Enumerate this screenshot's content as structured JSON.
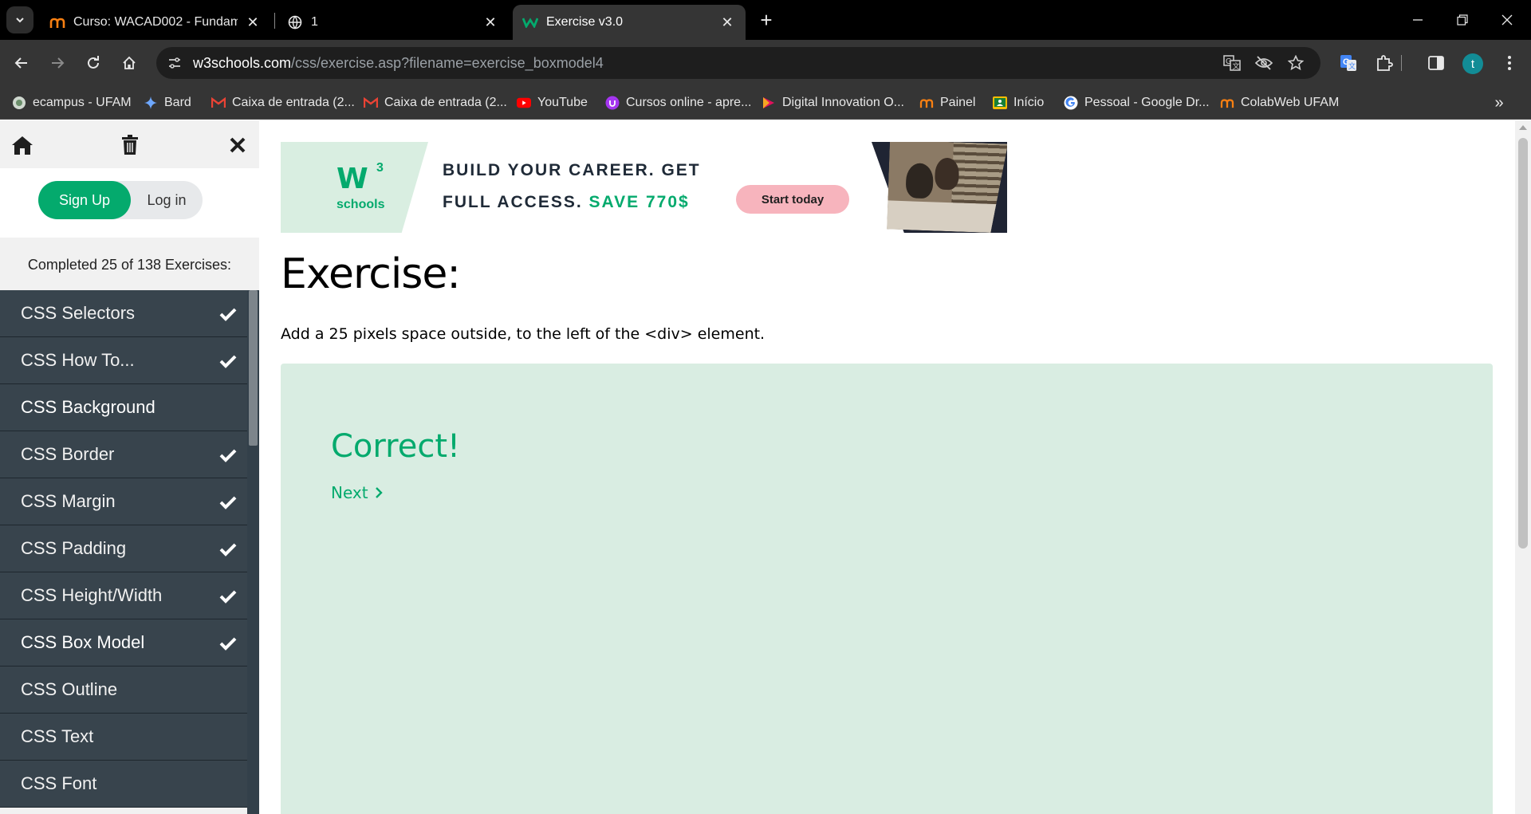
{
  "browser": {
    "tabs": [
      {
        "title": "Curso: WACAD002 - Fundamentos de",
        "favicon": "moodle-icon",
        "active": false
      },
      {
        "title": "1",
        "favicon": "globe-icon",
        "active": false
      },
      {
        "title": "Exercise v3.0",
        "favicon": "w3schools-icon",
        "active": true
      }
    ],
    "url": {
      "host": "w3schools.com",
      "path": "/css/exercise.asp?filename=exercise_boxmodel4"
    },
    "profile_initial": "t",
    "bookmarks": [
      {
        "label": "ecampus - UFAM",
        "icon": "ecampus-icon"
      },
      {
        "label": "Bard",
        "icon": "bard-icon"
      },
      {
        "label": "Caixa de entrada (2...",
        "icon": "gmail-icon"
      },
      {
        "label": "Caixa de entrada (2...",
        "icon": "gmail-icon"
      },
      {
        "label": "YouTube",
        "icon": "youtube-icon"
      },
      {
        "label": "Cursos online - apre...",
        "icon": "udemy-icon"
      },
      {
        "label": "Digital Innovation O...",
        "icon": "dio-icon"
      },
      {
        "label": "Painel",
        "icon": "moodle-icon"
      },
      {
        "label": "Início",
        "icon": "classroom-icon"
      },
      {
        "label": "Pessoal - Google Dr...",
        "icon": "google-icon"
      },
      {
        "label": "ColabWeb UFAM",
        "icon": "moodle-icon"
      }
    ]
  },
  "sidebar": {
    "signup_label": "Sign Up",
    "login_label": "Log in",
    "progress_text": "Completed 25 of 138 Exercises:",
    "items": [
      {
        "label": "CSS Selectors",
        "completed": true
      },
      {
        "label": "CSS How To...",
        "completed": true
      },
      {
        "label": "CSS Background",
        "completed": false
      },
      {
        "label": "CSS Border",
        "completed": true
      },
      {
        "label": "CSS Margin",
        "completed": true
      },
      {
        "label": "CSS Padding",
        "completed": true
      },
      {
        "label": "CSS Height/Width",
        "completed": true
      },
      {
        "label": "CSS Box Model",
        "completed": true
      },
      {
        "label": "CSS Outline",
        "completed": false
      },
      {
        "label": "CSS Text",
        "completed": false
      },
      {
        "label": "CSS Font",
        "completed": false
      }
    ]
  },
  "ad": {
    "logo_mark": "W",
    "logo_sup": "3",
    "logo_text": "schools",
    "line1": "BUILD YOUR CAREER. GET",
    "line2_prefix": "FULL ACCESS.",
    "line2_highlight": "SAVE 770$",
    "cta": "Start today"
  },
  "exercise": {
    "title": "Exercise:",
    "instruction": "Add a 25 pixels space outside, to the left of the <div> element.",
    "result": "Correct!",
    "next_label": "Next"
  },
  "colors": {
    "accent": "#04aa6d",
    "sidebar_item_bg": "#38444d",
    "exercise_bg": "#d9ede2",
    "cta_bg": "#f7b4bd"
  }
}
